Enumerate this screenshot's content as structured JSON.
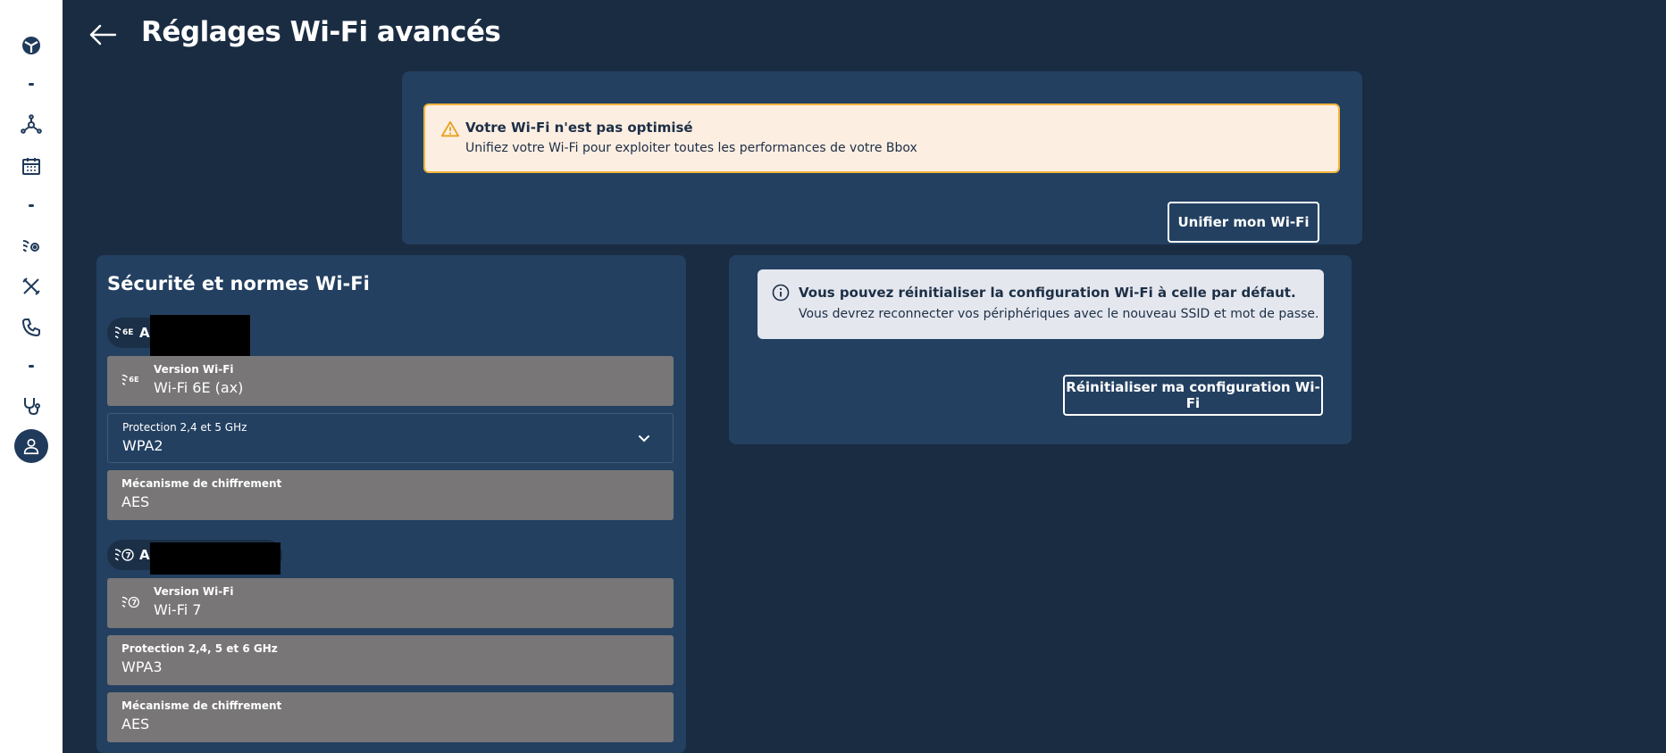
{
  "header": {
    "title": "Réglages Wi-Fi avancés"
  },
  "unify_card": {
    "alert_title": "Votre Wi-Fi n'est pas optimisé",
    "alert_text": "Unifiez votre Wi-Fi pour exploiter toutes les performances de votre Bbox",
    "button_label": "Unifier mon Wi-Fi"
  },
  "security": {
    "title": "Sécurité et normes Wi-Fi",
    "networks": [
      {
        "chip_label": "A",
        "version_label": "Version Wi-Fi",
        "version_value": "Wi-Fi 6E (ax)",
        "protection_label": "Protection 2,4 et 5 GHz",
        "protection_value": "WPA2",
        "encryption_label": "Mécanisme de chiffrement",
        "encryption_value": "AES"
      },
      {
        "chip_label": "A",
        "version_label": "Version Wi-Fi",
        "version_value": "Wi-Fi 7",
        "protection_label": "Protection 2,4, 5 et 6 GHz",
        "protection_value": "WPA3",
        "encryption_label": "Mécanisme de chiffrement",
        "encryption_value": "AES"
      }
    ]
  },
  "reset_card": {
    "alert_title": "Vous pouvez réinitialiser la configuration Wi-Fi à celle par défaut.",
    "alert_text": "Vous devrez reconnecter vos périphériques avec le nouveau SSID et mot de passe.",
    "button_label": "Réinitialiser ma configuration Wi-Fi"
  },
  "colors": {
    "background": "#1a2c42",
    "card": "#234061",
    "warning_bg": "#fdeee2",
    "warning_border": "#f0b53a",
    "info_bg": "#e5e7ef",
    "readonly_field": "#787677"
  }
}
